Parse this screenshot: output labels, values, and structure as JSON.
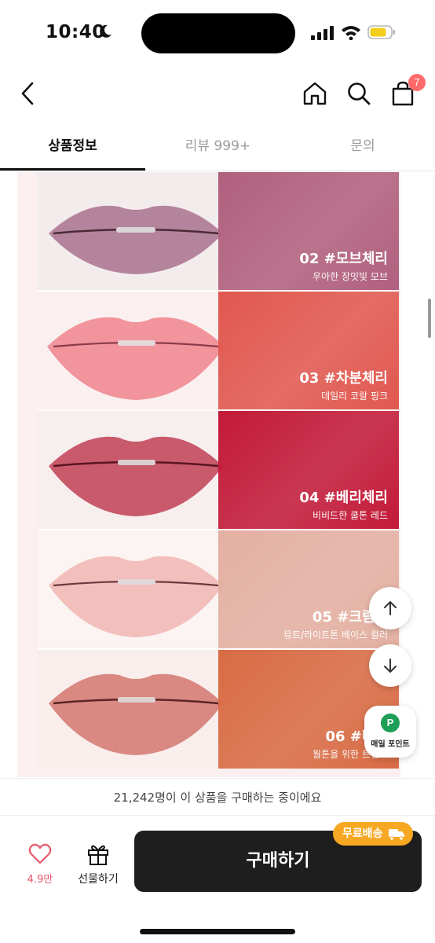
{
  "status_bar": {
    "time": "10:40"
  },
  "header": {
    "cart_count": "7"
  },
  "tabs": [
    {
      "label": "상품정보",
      "active": true
    },
    {
      "label": "리뷰 999+",
      "active": false
    },
    {
      "label": "문의",
      "active": false
    }
  ],
  "shades": [
    {
      "name": "02 #모브체리",
      "desc": "우아한 장밋빛 모브",
      "swatch_color": "#b0607e",
      "lip_color": "#b4849c"
    },
    {
      "name": "03 #차분체리",
      "desc": "데일리 코랄 핑크",
      "swatch_color": "#e0584f",
      "lip_color": "#f2949c"
    },
    {
      "name": "04 #베리체리",
      "desc": "비비드한 쿨톤 레드",
      "swatch_color": "#c21a38",
      "lip_color": "#c85a6c"
    },
    {
      "name": "05 #크림체",
      "desc": "뮤트/라이트톤 베이스 컬러",
      "swatch_color": "#e3b0a2",
      "lip_color": "#f2bfbc"
    },
    {
      "name": "06 #버터",
      "desc": "웜톤을 위한 트렌드",
      "swatch_color": "#d86b44",
      "lip_color": "#d98882"
    }
  ],
  "floating": {
    "points_label": "매일 포인트",
    "points_icon": "P"
  },
  "purchase": {
    "buyers_text": "21,242명이 이 상품을 구매하는 중이에요",
    "like_count": "4.9만",
    "gift_label": "선물하기",
    "buy_label": "구매하기",
    "shipping_badge": "무료배송"
  },
  "colors": {
    "accent": "#ff6b6b",
    "buy_button": "#1e1e1e",
    "shipping_badge": "#f7a823",
    "like": "#e4576a"
  }
}
